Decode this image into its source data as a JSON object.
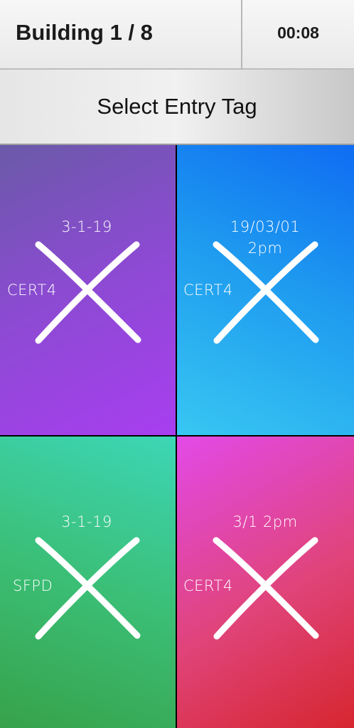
{
  "header": {
    "title": "Building 1 / 8",
    "timer": "00:08"
  },
  "select_button": {
    "label": "Select Entry Tag"
  },
  "tags": [
    {
      "date": "3-1-19",
      "time": "",
      "org": "CERT4",
      "mark": "x-mark-icon"
    },
    {
      "date": "19/03/01",
      "time": "2pm",
      "org": "CERT4",
      "mark": "x-mark-icon"
    },
    {
      "date": "3-1-19",
      "time": "",
      "org": "SFPD",
      "mark": "x-mark-icon"
    },
    {
      "date": "3/1  2pm",
      "time": "",
      "org": "CERT4",
      "mark": "x-mark-icon"
    }
  ],
  "colors": {
    "tile1": [
      "#6a5aa8",
      "#a83ef0"
    ],
    "tile2": [
      "#0f6cf2",
      "#38c7f2"
    ],
    "tile3": [
      "#37a24a",
      "#3dd6b6"
    ],
    "tile4": [
      "#e24ae8",
      "#d6262f"
    ],
    "mark": "#ffffff"
  }
}
